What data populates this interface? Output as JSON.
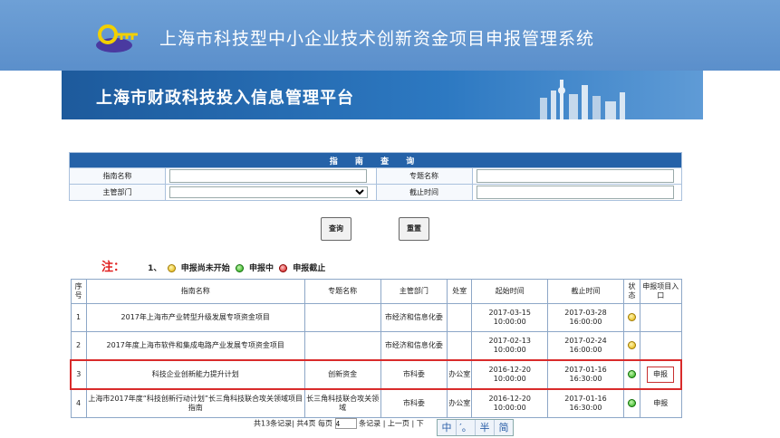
{
  "header": {
    "system_title": "上海市科技型中小企业技术创新资金项目申报管理系统",
    "platform_title": "上海市财政科技投入信息管理平台"
  },
  "search": {
    "title": "指 南 查 询",
    "guide_name_label": "指南名称",
    "topic_name_label": "专题名称",
    "dept_label": "主管部门",
    "deadline_label": "截止时间",
    "guide_name_value": "",
    "topic_name_value": "",
    "dept_value": "",
    "deadline_value": "",
    "query_button": "查询",
    "reset_button": "重置"
  },
  "legend": {
    "note": "注：",
    "prefix": "1、",
    "not_started": "申报尚未开始",
    "in_progress": "申报中",
    "closed": "申报截止"
  },
  "table": {
    "headers": [
      "序号",
      "指南名称",
      "专题名称",
      "主管部门",
      "处室",
      "起始时间",
      "截止时间",
      "状态",
      "申报项目入口"
    ],
    "rows": [
      {
        "no": "1",
        "name": "2017年上海市产业转型升级发展专项资金项目",
        "topic": "",
        "dept": "市经济和信息化委",
        "office": "",
        "start": "2017-03-15 10:00:00",
        "end": "2017-03-28 16:00:00",
        "status": "yellow",
        "entry": ""
      },
      {
        "no": "2",
        "name": "2017年度上海市软件和集成电路产业发展专项资金项目",
        "topic": "",
        "dept": "市经济和信息化委",
        "office": "",
        "start": "2017-02-13 10:00:00",
        "end": "2017-02-24 16:00:00",
        "status": "yellow",
        "entry": ""
      },
      {
        "no": "3",
        "name": "科技企业创新能力提升计划",
        "topic": "创新资金",
        "dept": "市科委",
        "office": "办公室",
        "start": "2016-12-20 10:00:00",
        "end": "2017-01-16 16:30:00",
        "status": "green",
        "entry": "申报"
      },
      {
        "no": "4",
        "name": "上海市2017年度“科技创新行动计划”长三角科技联合攻关领域项目指南",
        "topic": "长三角科技联合攻关领域",
        "dept": "市科委",
        "office": "办公室",
        "start": "2016-12-20 10:00:00",
        "end": "2017-01-16 16:30:00",
        "status": "green",
        "entry": "申报"
      }
    ]
  },
  "pager": {
    "text1": "共13条记录| 共4页 每页",
    "per_page": "4",
    "text2": "条记录 | 上一页 | 下"
  },
  "ime": [
    "中",
    "′。",
    "半",
    "简"
  ]
}
